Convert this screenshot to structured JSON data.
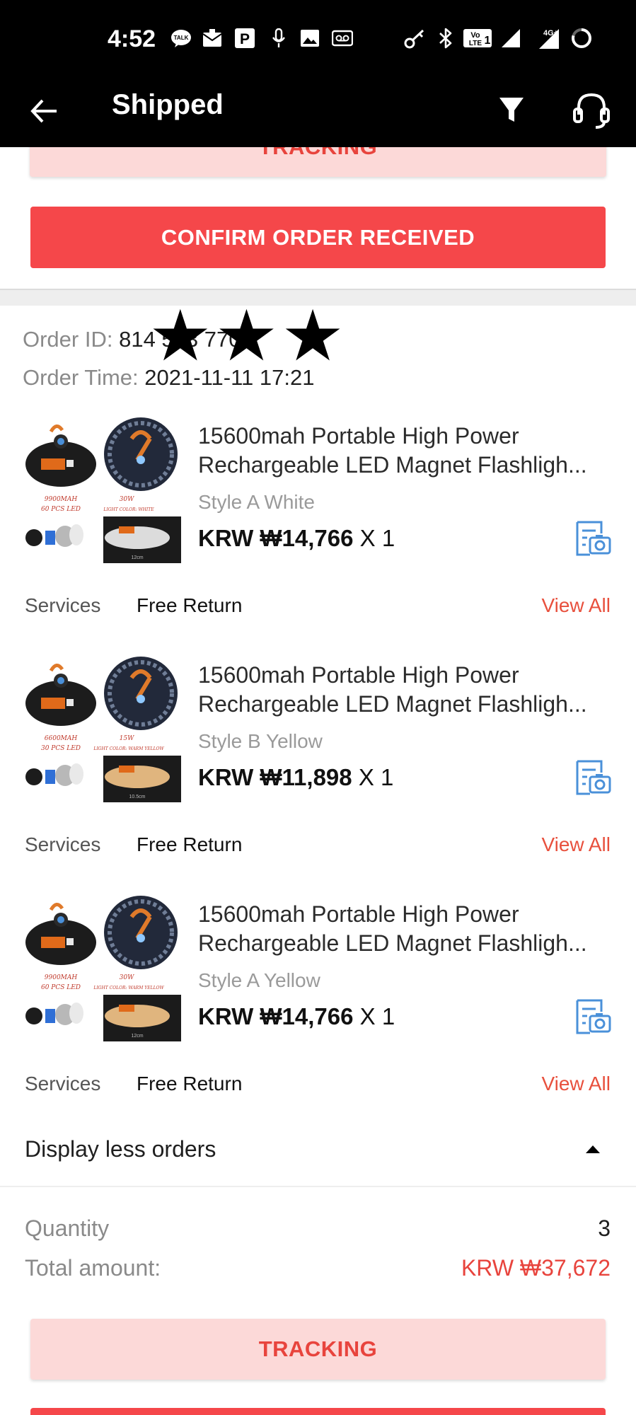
{
  "status_bar": {
    "time": "4:52",
    "left_icons": [
      "talk-icon",
      "mail-icon",
      "parking-icon",
      "mic-icon",
      "image-icon",
      "voicemail-icon"
    ],
    "right_icons": [
      "key-icon",
      "bluetooth-icon",
      "volte-icon",
      "signal-icon",
      "signal-4g-icon",
      "battery-icon"
    ],
    "network": "4G+"
  },
  "header": {
    "title": "Shipped",
    "back_icon": "back-arrow-icon",
    "filter_icon": "filter-icon",
    "support_icon": "headset-icon"
  },
  "prev_order": {
    "tracking_label": "TRACKING",
    "confirm_label": "CONFIRM ORDER RECEIVED"
  },
  "order": {
    "id_label": "Order ID:",
    "id_value": "814  553  770",
    "time_label": "Order Time:",
    "time_value": "2021-11-11 17:21",
    "redaction_marks": "★★★",
    "items": [
      {
        "title": "15600mah Portable High Power Rechargeable LED Magnet Flashligh...",
        "variant": "Style A  White",
        "price": "KRW ₩14,766",
        "qty": "X 1",
        "services_label": "Services",
        "service_value": "Free Return",
        "view_all": "View All",
        "thumb": {
          "capacity": "9900MAH",
          "watt": "30W",
          "leds": "60 PCS LED",
          "light": "LIGHT COLOR: WHITE",
          "size": "12cm",
          "glow": "#f2f2f2"
        }
      },
      {
        "title": "15600mah Portable High Power Rechargeable LED Magnet Flashligh...",
        "variant": "Style B  Yellow",
        "price": "KRW ₩11,898",
        "qty": "X 1",
        "services_label": "Services",
        "service_value": "Free Return",
        "view_all": "View All",
        "thumb": {
          "capacity": "6600MAH",
          "watt": "15W",
          "leds": "30 PCS LED",
          "light": "LIGHT COLOR: WARM YELLOW",
          "size": "10.5cm",
          "glow": "#f6c78a"
        }
      },
      {
        "title": "15600mah Portable High Power Rechargeable LED Magnet Flashligh...",
        "variant": "Style A  Yellow",
        "price": "KRW ₩14,766",
        "qty": "X 1",
        "services_label": "Services",
        "service_value": "Free Return",
        "view_all": "View All",
        "thumb": {
          "capacity": "9900MAH",
          "watt": "30W",
          "leds": "60 PCS LED",
          "light": "LIGHT COLOR: WARM YELLOW",
          "size": "12cm",
          "glow": "#f6c78a"
        }
      }
    ],
    "display_less": "Display less orders",
    "quantity_label": "Quantity",
    "quantity_value": "3",
    "total_label": "Total amount:",
    "total_value": "KRW ₩37,672",
    "tracking_label": "TRACKING"
  },
  "colors": {
    "accent_red": "#f5474a",
    "pink_button": "#fcd9d8",
    "view_all": "#e8503d",
    "icon_blue": "#4a90d9"
  }
}
